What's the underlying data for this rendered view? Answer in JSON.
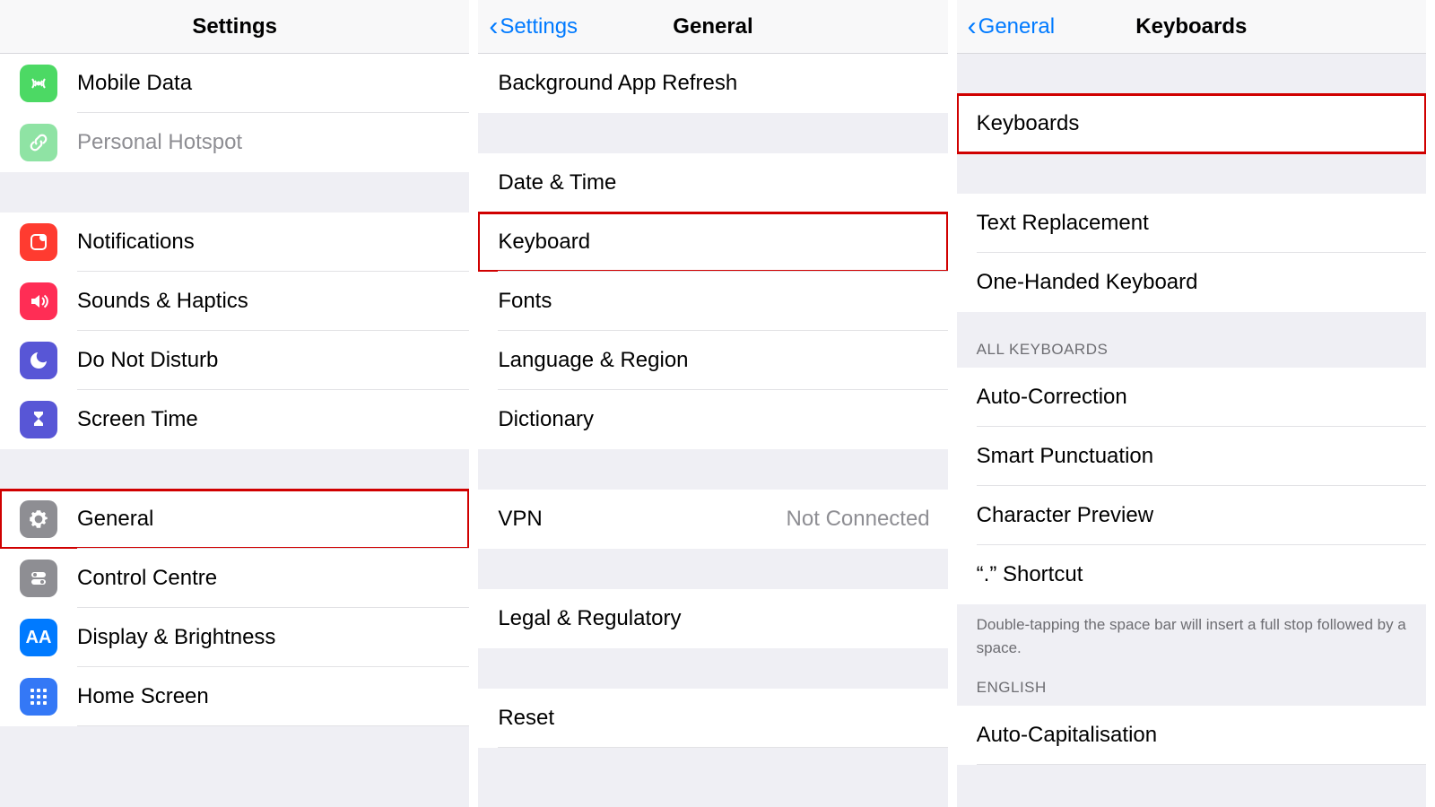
{
  "panel1": {
    "title": "Settings",
    "rows": {
      "mobile_data": "Mobile Data",
      "personal_hotspot": "Personal Hotspot",
      "notifications": "Notifications",
      "sounds": "Sounds & Haptics",
      "dnd": "Do Not Disturb",
      "screen_time": "Screen Time",
      "general": "General",
      "control_centre": "Control Centre",
      "display": "Display & Brightness",
      "home_screen": "Home Screen"
    }
  },
  "panel2": {
    "back": "Settings",
    "title": "General",
    "rows": {
      "bg_refresh": "Background App Refresh",
      "date_time": "Date & Time",
      "keyboard": "Keyboard",
      "fonts": "Fonts",
      "language": "Language & Region",
      "dictionary": "Dictionary",
      "vpn": "VPN",
      "vpn_value": "Not Connected",
      "legal": "Legal & Regulatory",
      "reset": "Reset"
    }
  },
  "panel3": {
    "back": "General",
    "title": "Keyboards",
    "rows": {
      "keyboards": "Keyboards",
      "text_replacement": "Text Replacement",
      "one_handed": "One-Handed Keyboard"
    },
    "section_all": "ALL KEYBOARDS",
    "all_rows": {
      "auto_correction": "Auto-Correction",
      "smart_punctuation": "Smart Punctuation",
      "character_preview": "Character Preview",
      "dot_shortcut": "“.” Shortcut"
    },
    "footer": "Double-tapping the space bar will insert a full stop followed by a space.",
    "section_english": "ENGLISH",
    "english_rows": {
      "auto_cap": "Auto-Capitalisation"
    }
  }
}
